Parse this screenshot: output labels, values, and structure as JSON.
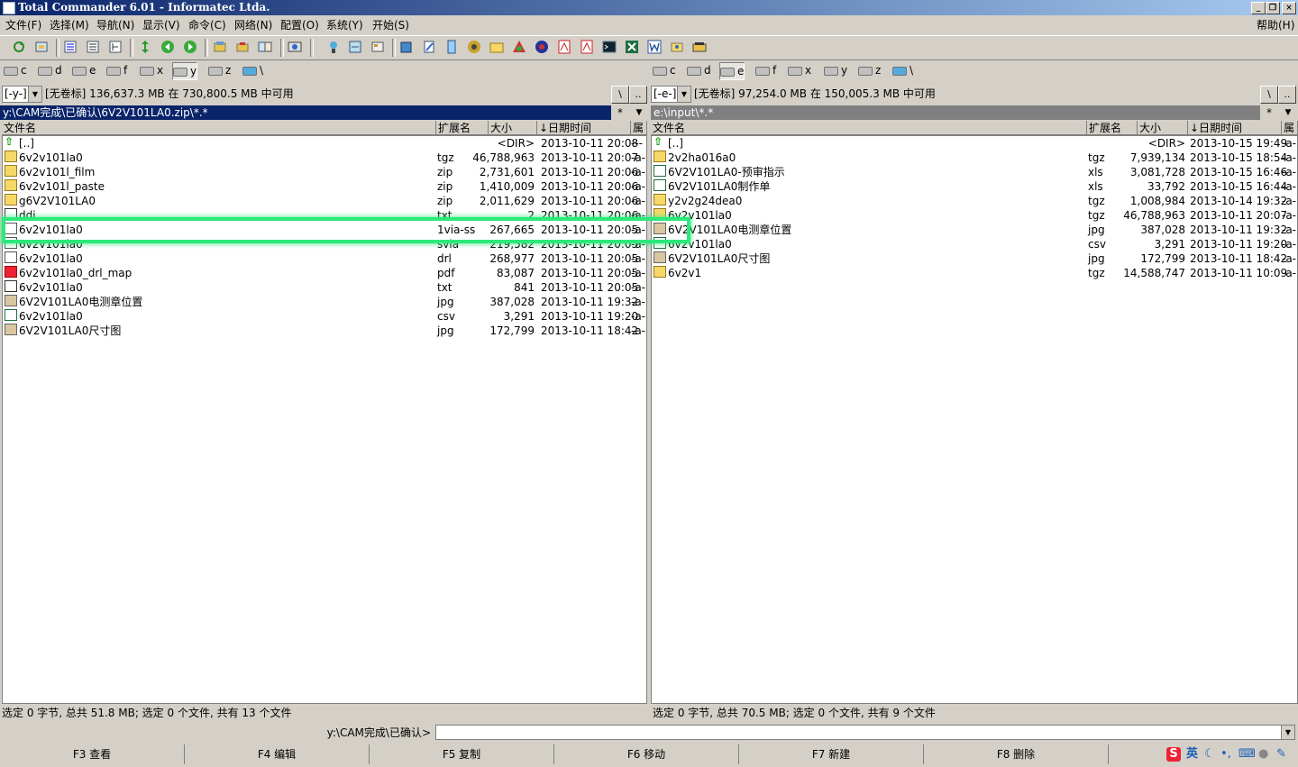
{
  "title": "Total Commander 6.01 - Informatec Ltda.",
  "window_buttons": [
    "_",
    "❐",
    "×"
  ],
  "menu": [
    "文件(F)",
    "选择(M)",
    "导航(N)",
    "显示(V)",
    "命令(C)",
    "网络(N)",
    "配置(O)",
    "系统(Y)",
    "开始(S)"
  ],
  "help": "帮助(H)",
  "left": {
    "drives": [
      "c",
      "d",
      "e",
      "f",
      "x",
      "y",
      "z",
      "\\"
    ],
    "selected_drive": "y",
    "drive_combo": "[-y-]",
    "free": "[无卷标]  136,637.3 MB 在 730,800.5 MB 中可用",
    "root_btn": "\\",
    "up_btn": "..",
    "path": "y:\\CAM完成\\已确认\\6V2V101LA0.zip\\*.*",
    "star": "*",
    "headers": {
      "name": "文件名",
      "ext": "扩展名",
      "size": "大小",
      "date": "↓日期时间",
      "attr": "属"
    },
    "files": [
      {
        "icon": "up",
        "name": "[..]",
        "ext": "",
        "size": "<DIR>",
        "date": "2013-10-11 20:08",
        "attr": "---"
      },
      {
        "icon": "folder",
        "name": "6v2v101la0",
        "ext": "tgz",
        "size": "46,788,963",
        "date": "2013-10-11 20:07",
        "attr": "-a-"
      },
      {
        "icon": "folder",
        "name": "6v2v101l_film",
        "ext": "zip",
        "size": "2,731,601",
        "date": "2013-10-11 20:06",
        "attr": "-a-"
      },
      {
        "icon": "folder",
        "name": "6v2v101l_paste",
        "ext": "zip",
        "size": "1,410,009",
        "date": "2013-10-11 20:06",
        "attr": "-a-"
      },
      {
        "icon": "folder",
        "name": "g6V2V101LA0",
        "ext": "zip",
        "size": "2,011,629",
        "date": "2013-10-11 20:06",
        "attr": "-a-"
      },
      {
        "icon": "txt",
        "name": "ddi",
        "ext": "txt",
        "size": "2",
        "date": "2013-10-11 20:06",
        "attr": "-a-"
      },
      {
        "icon": "file",
        "name": "6v2v101la0",
        "ext": "1via-ss",
        "size": "267,665",
        "date": "2013-10-11 20:05",
        "attr": "-a-"
      },
      {
        "icon": "file",
        "name": "6v2v101la0",
        "ext": "svia",
        "size": "219,582",
        "date": "2013-10-11 20:05",
        "attr": "-a-"
      },
      {
        "icon": "file",
        "name": "6v2v101la0",
        "ext": "drl",
        "size": "268,977",
        "date": "2013-10-11 20:05",
        "attr": "-a-"
      },
      {
        "icon": "pdf",
        "name": "6v2v101la0_drl_map",
        "ext": "pdf",
        "size": "83,087",
        "date": "2013-10-11 20:05",
        "attr": "-a-"
      },
      {
        "icon": "txt",
        "name": "6v2v101la0",
        "ext": "txt",
        "size": "841",
        "date": "2013-10-11 20:05",
        "attr": "-a-"
      },
      {
        "icon": "jpg",
        "name": "6V2V101LA0电测章位置",
        "ext": "jpg",
        "size": "387,028",
        "date": "2013-10-11 19:32",
        "attr": "-a-"
      },
      {
        "icon": "xls",
        "name": "6v2v101la0",
        "ext": "csv",
        "size": "3,291",
        "date": "2013-10-11 19:20",
        "attr": "-a-"
      },
      {
        "icon": "jpg",
        "name": "6V2V101LA0尺寸图",
        "ext": "jpg",
        "size": "172,799",
        "date": "2013-10-11 18:42",
        "attr": "-a-"
      }
    ],
    "status": "选定 0 字节, 总共 51.8 MB; 选定 0 个文件, 共有 13 个文件"
  },
  "right": {
    "drives": [
      "c",
      "d",
      "e",
      "f",
      "x",
      "y",
      "z",
      "\\"
    ],
    "selected_drive": "e",
    "drive_combo": "[-e-]",
    "free": "[无卷标]  97,254.0 MB 在 150,005.3 MB 中可用",
    "root_btn": "\\",
    "up_btn": "..",
    "path": "e:\\input\\*.*",
    "star": "*",
    "headers": {
      "name": "文件名",
      "ext": "扩展名",
      "size": "大小",
      "date": "↓日期时间",
      "attr": "属"
    },
    "files": [
      {
        "icon": "up",
        "name": "[..]",
        "ext": "",
        "size": "<DIR>",
        "date": "2013-10-15 19:49",
        "attr": "-a-"
      },
      {
        "icon": "folder",
        "name": "2v2ha016a0",
        "ext": "tgz",
        "size": "7,939,134",
        "date": "2013-10-15 18:54",
        "attr": "-a-"
      },
      {
        "icon": "xls",
        "name": "6V2V101LA0-预审指示",
        "ext": "xls",
        "size": "3,081,728",
        "date": "2013-10-15 16:46",
        "attr": "-a-"
      },
      {
        "icon": "xls",
        "name": "6V2V101LA0制作单",
        "ext": "xls",
        "size": "33,792",
        "date": "2013-10-15 16:44",
        "attr": "-a-"
      },
      {
        "icon": "folder",
        "name": "y2v2g24dea0",
        "ext": "tgz",
        "size": "1,008,984",
        "date": "2013-10-14 19:32",
        "attr": "-a-"
      },
      {
        "icon": "folder",
        "name": "6v2v101la0",
        "ext": "tgz",
        "size": "46,788,963",
        "date": "2013-10-11 20:07",
        "attr": "-a-"
      },
      {
        "icon": "jpg",
        "name": "6V2V101LA0电测章位置",
        "ext": "jpg",
        "size": "387,028",
        "date": "2013-10-11 19:32",
        "attr": "-a-"
      },
      {
        "icon": "xls",
        "name": "6v2v101la0",
        "ext": "csv",
        "size": "3,291",
        "date": "2013-10-11 19:20",
        "attr": "-a-"
      },
      {
        "icon": "jpg",
        "name": "6V2V101LA0尺寸图",
        "ext": "jpg",
        "size": "172,799",
        "date": "2013-10-11 18:42",
        "attr": "-a-"
      },
      {
        "icon": "folder",
        "name": "6v2v1",
        "ext": "tgz",
        "size": "14,588,747",
        "date": "2013-10-11 10:09",
        "attr": "-a-"
      }
    ],
    "status": "选定 0 字节, 总共 70.5 MB; 选定 0 个文件, 共有 9 个文件"
  },
  "cmdline_label": "y:\\CAM完成\\已确认>",
  "fkeys": [
    "F3 查看",
    "F4 编辑",
    "F5 复制",
    "F6 移动",
    "F7 新建",
    "F8 删除"
  ],
  "tray": {
    "ime_logo": "S",
    "lang": "英"
  }
}
